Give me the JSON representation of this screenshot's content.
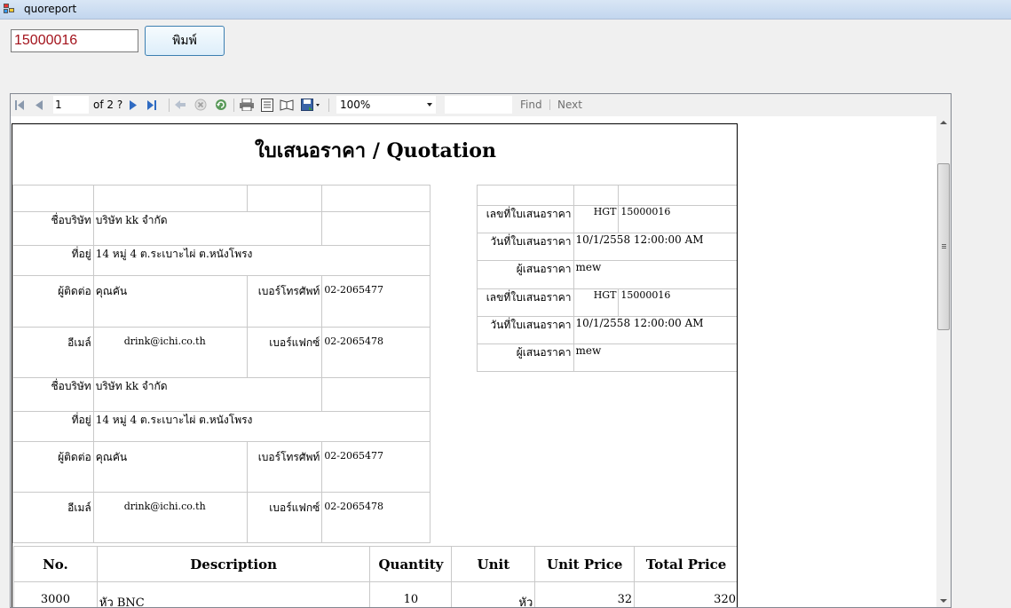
{
  "window": {
    "title": "quoreport"
  },
  "controls": {
    "quotation_number": "15000016",
    "print_label": "พิมพ์"
  },
  "toolbar": {
    "page_current": "1",
    "page_total": "of  2 ?",
    "zoom": "100%",
    "find_label": "Find",
    "next_label": "Next"
  },
  "report": {
    "title": "ใบเสนอราคา / Quotation",
    "customer_blocks": [
      {
        "company_label": "ชื่อบริษัท",
        "company_value": "บริษัท   kk   จำกัด",
        "address_label": "ที่อยู่",
        "address_value": "14   หมู่ 4 ต.ระเบาะไผ่ ต.หนังโพรง",
        "contact_label": "ผู้ติดต่อ",
        "contact_value": "คุณคัน",
        "phone_label": "เบอร์โทรศัพท์",
        "phone_value": "02-2065477",
        "email_label": "อีเมล์",
        "email_value": "drink@ichi.co.th",
        "fax_label": "เบอร์แฟกซ์",
        "fax_value": "02-2065478"
      },
      {
        "company_label": "ชื่อบริษัท",
        "company_value": "บริษัท   kk   จำกัด",
        "address_label": "ที่อยู่",
        "address_value": "14   หมู่ 4 ต.ระเบาะไผ่ ต.หนังโพรง",
        "contact_label": "ผู้ติดต่อ",
        "contact_value": "คุณคัน",
        "phone_label": "เบอร์โทรศัพท์",
        "phone_value": "02-2065477",
        "email_label": "อีเมล์",
        "email_value": "drink@ichi.co.th",
        "fax_label": "เบอร์แฟกซ์",
        "fax_value": "02-2065478"
      }
    ],
    "info_blocks": [
      {
        "number_label": "เลขที่ใบเสนอราคา",
        "number_prefix": "HGT",
        "number_value": "15000016",
        "date_label": "วันที่ใบเสนอราคา",
        "date_value": "10/1/2558 12:00:00 AM",
        "by_label": "ผู้เสนอราคา",
        "by_value": "mew"
      },
      {
        "number_label": "เลขที่ใบเสนอราคา",
        "number_prefix": "HGT",
        "number_value": "15000016",
        "date_label": "วันที่ใบเสนอราคา",
        "date_value": "10/1/2558 12:00:00 AM",
        "by_label": "ผู้เสนอราคา",
        "by_value": "mew"
      }
    ],
    "items": {
      "headers": [
        "No.",
        "Description",
        "Quantity",
        "Unit",
        "Unit Price",
        "Total Price"
      ],
      "rows": [
        [
          "3000",
          "หัว BNC",
          "10",
          "หัว",
          "32",
          "320"
        ]
      ]
    }
  }
}
